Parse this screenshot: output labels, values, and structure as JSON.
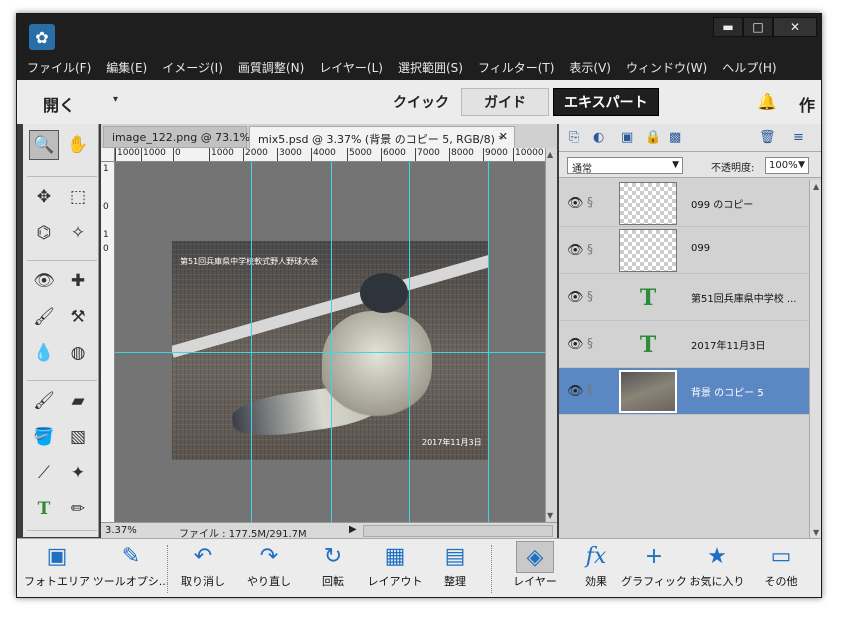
{
  "window": {
    "logo_icon": "app-logo-icon",
    "min_glyph": "▬",
    "max_glyph": "□",
    "close_glyph": "✕"
  },
  "menu": [
    "ファイル(F)",
    "編集(E)",
    "イメージ(I)",
    "画質調整(N)",
    "レイヤー(L)",
    "選択範囲(S)",
    "フィルター(T)",
    "表示(V)",
    "ウィンドウ(W)",
    "ヘルプ(H)"
  ],
  "modebar": {
    "open_label": "開く",
    "open_caret": "▾",
    "quick": "クイック",
    "guide": "ガイド",
    "expert": "エキスパート",
    "create_label": "作"
  },
  "tabs": [
    {
      "label": "image_122.png @ 73.1%...",
      "close": ""
    },
    {
      "label": "mix5.psd @ 3.37% (背景 のコピー 5, RGB/8) *",
      "close": "✕"
    }
  ],
  "ruler": {
    "top_ticks": [
      "1000",
      "1000",
      "0",
      "1000",
      "2000",
      "3000",
      "4000",
      "5000",
      "6000",
      "7000",
      "8000",
      "9000",
      "10000"
    ],
    "left_ticks": [
      "1",
      "0",
      "1",
      "0"
    ]
  },
  "canvas": {
    "caption_text": "第51回兵庫県中学校軟式野人野球大会",
    "date_text": "2017年11月3日"
  },
  "status": {
    "zoom": "3.37%",
    "file_info": "ファイル : 177.5M/291.7M",
    "arrow": "▶"
  },
  "layers_panel": {
    "blend_mode": "通常",
    "opacity_label": "不透明度:",
    "opacity_value": "100%",
    "layers": [
      {
        "name": "099 のコピー",
        "kind": "empty",
        "selected": false
      },
      {
        "name": "099",
        "kind": "empty",
        "selected": false
      },
      {
        "name": "第51回兵庫県中学校 ...",
        "kind": "type",
        "selected": false
      },
      {
        "name": "2017年11月3日",
        "kind": "type",
        "selected": false
      },
      {
        "name": "背景 のコピー 5",
        "kind": "photo",
        "selected": true
      }
    ],
    "type_glyph": "T",
    "eye_glyph": "👁",
    "link_glyph": "§"
  },
  "taskbar": [
    {
      "label": "フォトエリア",
      "icon": "photo-bin-icon",
      "glyph": "▣"
    },
    {
      "label": "ツールオプシ...",
      "icon": "tool-options-icon",
      "glyph": "✎"
    },
    {
      "label": "取り消し",
      "icon": "undo-icon",
      "glyph": "↶"
    },
    {
      "label": "やり直し",
      "icon": "redo-icon",
      "glyph": "↷"
    },
    {
      "label": "回転",
      "icon": "rotate-icon",
      "glyph": "↻"
    },
    {
      "label": "レイアウト",
      "icon": "layout-icon",
      "glyph": "▦"
    },
    {
      "label": "整理",
      "icon": "organizer-icon",
      "glyph": "▤"
    },
    {
      "label": "レイヤー",
      "icon": "layers-icon",
      "glyph": "◈"
    },
    {
      "label": "効果",
      "icon": "fx-icon",
      "glyph": "fx"
    },
    {
      "label": "グラフィック",
      "icon": "graphics-icon",
      "glyph": "+"
    },
    {
      "label": "お気に入り",
      "icon": "favorites-icon",
      "glyph": "★"
    },
    {
      "label": "その他",
      "icon": "more-icon",
      "glyph": "▭"
    }
  ],
  "colors": {
    "guide": "#3ad8e6",
    "accent": "#1f6fc2",
    "selected_layer": "#5b87c2"
  }
}
